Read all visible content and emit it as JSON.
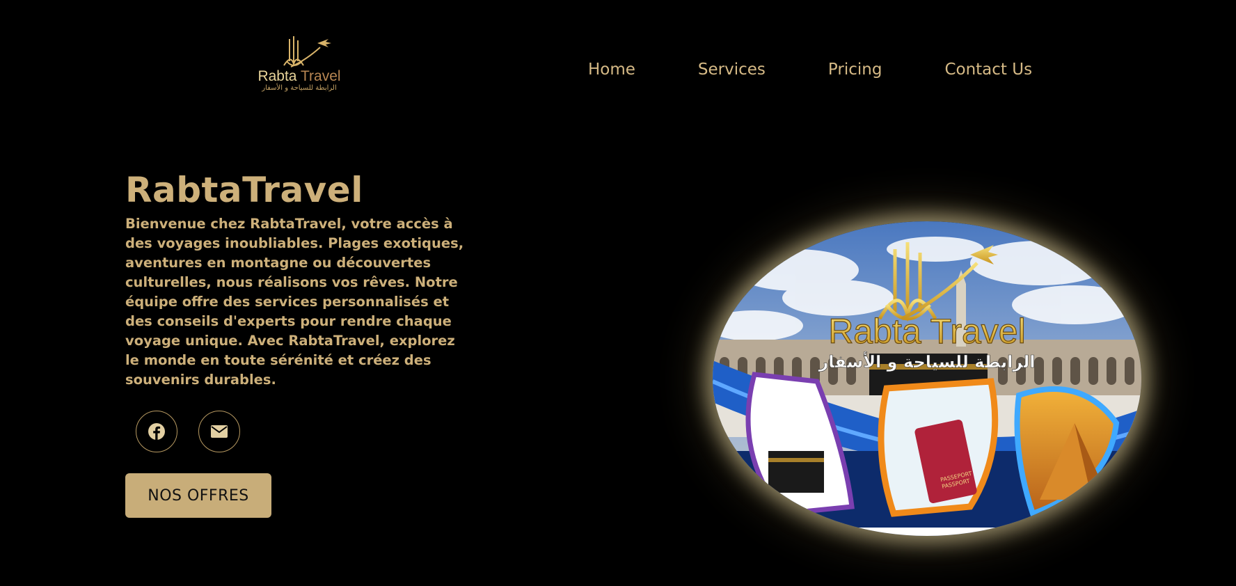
{
  "brand": {
    "logo_text_primary": "Rabta",
    "logo_text_secondary": "Travel",
    "logo_arabic": "الرابطة للسياحة و الأسفار"
  },
  "nav": {
    "items": [
      {
        "label": "Home"
      },
      {
        "label": "Services"
      },
      {
        "label": "Pricing"
      },
      {
        "label": "Contact Us"
      }
    ]
  },
  "hero": {
    "title": "RabtaTravel",
    "description": "Bienvenue chez RabtaTravel, votre accès à des voyages inoubliables. Plages exotiques, aventures en montagne ou découvertes culturelles, nous réalisons vos rêves. Notre équipe offre des services personnalisés et des conseils d'experts pour rendre chaque voyage unique. Avec RabtaTravel, explorez le monde en toute sérénité et créez des souvenirs durables.",
    "cta_label": "NOS OFFRES",
    "socials": [
      {
        "icon": "facebook-icon"
      },
      {
        "icon": "envelope-icon"
      }
    ]
  },
  "image_banner": {
    "title_primary": "Rabta Travel",
    "title_arabic": "الرابطة للسياحة و الأسفار",
    "passport_label_1": "PASSEPORT",
    "passport_label_2": "PASSPORT"
  },
  "colors": {
    "accent": "#cdb07a",
    "background": "#000000",
    "button": "#c8ad79"
  }
}
